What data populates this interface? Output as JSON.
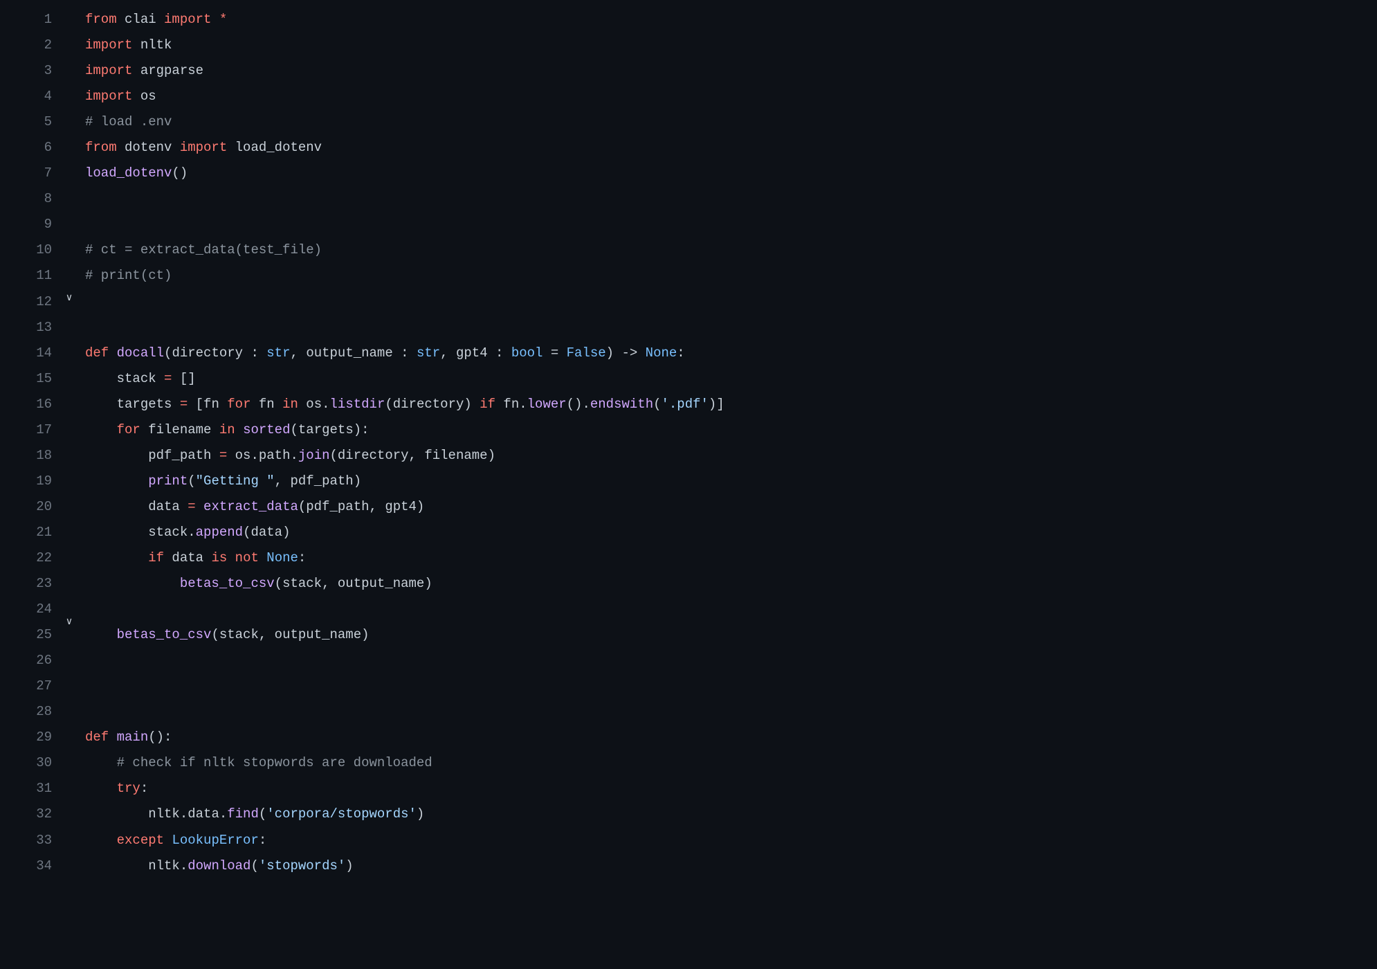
{
  "lines": [
    {
      "n": 1,
      "fold": "",
      "tokens": [
        [
          "kw-import",
          "from"
        ],
        [
          "",
          ""
        ],
        [
          "ident",
          " clai "
        ],
        [
          "kw-import",
          "import"
        ],
        [
          "op",
          " *"
        ]
      ]
    },
    {
      "n": 2,
      "fold": "",
      "tokens": [
        [
          "kw-import",
          "import"
        ],
        [
          "ident",
          " nltk"
        ]
      ]
    },
    {
      "n": 3,
      "fold": "",
      "tokens": [
        [
          "kw-import",
          "import"
        ],
        [
          "ident",
          " argparse"
        ]
      ]
    },
    {
      "n": 4,
      "fold": "",
      "tokens": [
        [
          "kw-import",
          "import"
        ],
        [
          "ident",
          " os"
        ]
      ]
    },
    {
      "n": 5,
      "fold": "",
      "tokens": [
        [
          "comment",
          "# load .env"
        ]
      ]
    },
    {
      "n": 6,
      "fold": "",
      "tokens": [
        [
          "kw-import",
          "from"
        ],
        [
          "ident",
          " dotenv "
        ],
        [
          "kw-import",
          "import"
        ],
        [
          "ident",
          " load_dotenv"
        ]
      ]
    },
    {
      "n": 7,
      "fold": "",
      "tokens": [
        [
          "call",
          "load_dotenv"
        ],
        [
          "punct",
          "()"
        ]
      ]
    },
    {
      "n": 8,
      "fold": "",
      "tokens": [
        [
          "",
          ""
        ]
      ]
    },
    {
      "n": 9,
      "fold": "",
      "tokens": [
        [
          "",
          ""
        ]
      ]
    },
    {
      "n": 10,
      "fold": "",
      "tokens": [
        [
          "comment",
          "# ct = extract_data(test_file)"
        ]
      ]
    },
    {
      "n": 11,
      "fold": "",
      "tokens": [
        [
          "comment",
          "# print(ct)"
        ]
      ]
    },
    {
      "n": 12,
      "fold": "",
      "tokens": [
        [
          "",
          ""
        ]
      ]
    },
    {
      "n": 13,
      "fold": "",
      "tokens": [
        [
          "",
          ""
        ]
      ]
    },
    {
      "n": 14,
      "fold": "v",
      "tokens": [
        [
          "kw-def",
          "def "
        ],
        [
          "fn",
          "docall"
        ],
        [
          "punct",
          "("
        ],
        [
          "param",
          "directory"
        ],
        [
          "punct",
          " : "
        ],
        [
          "builtin-type",
          "str"
        ],
        [
          "punct",
          ", "
        ],
        [
          "param",
          "output_name"
        ],
        [
          "punct",
          " : "
        ],
        [
          "builtin-type",
          "str"
        ],
        [
          "punct",
          ", "
        ],
        [
          "param",
          "gpt4"
        ],
        [
          "punct",
          " : "
        ],
        [
          "builtin-type",
          "bool"
        ],
        [
          "punct",
          " = "
        ],
        [
          "const",
          "False"
        ],
        [
          "punct",
          ") -> "
        ],
        [
          "const",
          "None"
        ],
        [
          "punct",
          ":"
        ]
      ]
    },
    {
      "n": 15,
      "fold": "",
      "tokens": [
        [
          "ident",
          "    stack "
        ],
        [
          "op",
          "="
        ],
        [
          "punct",
          " []"
        ]
      ]
    },
    {
      "n": 16,
      "fold": "",
      "tokens": [
        [
          "ident",
          "    targets "
        ],
        [
          "op",
          "="
        ],
        [
          "punct",
          " ["
        ],
        [
          "ident",
          "fn "
        ],
        [
          "kw-flow",
          "for"
        ],
        [
          "ident",
          " fn "
        ],
        [
          "kw-flow",
          "in"
        ],
        [
          "ident",
          " os"
        ],
        [
          "punct",
          "."
        ],
        [
          "call",
          "listdir"
        ],
        [
          "punct",
          "("
        ],
        [
          "ident",
          "directory"
        ],
        [
          "punct",
          ") "
        ],
        [
          "kw-flow",
          "if"
        ],
        [
          "ident",
          " fn"
        ],
        [
          "punct",
          "."
        ],
        [
          "call",
          "lower"
        ],
        [
          "punct",
          "()."
        ],
        [
          "call",
          "endswith"
        ],
        [
          "punct",
          "("
        ],
        [
          "string",
          "'.pdf'"
        ],
        [
          "punct",
          ")]"
        ]
      ]
    },
    {
      "n": 17,
      "fold": "",
      "tokens": [
        [
          "ident",
          "    "
        ],
        [
          "kw-flow",
          "for"
        ],
        [
          "ident",
          " filename "
        ],
        [
          "kw-flow",
          "in"
        ],
        [
          "ident",
          " "
        ],
        [
          "call",
          "sorted"
        ],
        [
          "punct",
          "("
        ],
        [
          "ident",
          "targets"
        ],
        [
          "punct",
          "):"
        ]
      ]
    },
    {
      "n": 18,
      "fold": "",
      "tokens": [
        [
          "ident",
          "        pdf_path "
        ],
        [
          "op",
          "="
        ],
        [
          "ident",
          " os"
        ],
        [
          "punct",
          "."
        ],
        [
          "ident",
          "path"
        ],
        [
          "punct",
          "."
        ],
        [
          "call",
          "join"
        ],
        [
          "punct",
          "("
        ],
        [
          "ident",
          "directory"
        ],
        [
          "punct",
          ", "
        ],
        [
          "ident",
          "filename"
        ],
        [
          "punct",
          ")"
        ]
      ]
    },
    {
      "n": 19,
      "fold": "",
      "tokens": [
        [
          "ident",
          "        "
        ],
        [
          "call",
          "print"
        ],
        [
          "punct",
          "("
        ],
        [
          "string",
          "\"Getting \""
        ],
        [
          "punct",
          ", "
        ],
        [
          "ident",
          "pdf_path"
        ],
        [
          "punct",
          ")"
        ]
      ]
    },
    {
      "n": 20,
      "fold": "",
      "tokens": [
        [
          "ident",
          "        data "
        ],
        [
          "op",
          "="
        ],
        [
          "ident",
          " "
        ],
        [
          "call",
          "extract_data"
        ],
        [
          "punct",
          "("
        ],
        [
          "ident",
          "pdf_path"
        ],
        [
          "punct",
          ", "
        ],
        [
          "ident",
          "gpt4"
        ],
        [
          "punct",
          ")"
        ]
      ]
    },
    {
      "n": 21,
      "fold": "",
      "tokens": [
        [
          "ident",
          "        stack"
        ],
        [
          "punct",
          "."
        ],
        [
          "call",
          "append"
        ],
        [
          "punct",
          "("
        ],
        [
          "ident",
          "data"
        ],
        [
          "punct",
          ")"
        ]
      ]
    },
    {
      "n": 22,
      "fold": "",
      "tokens": [
        [
          "ident",
          "        "
        ],
        [
          "kw-flow",
          "if"
        ],
        [
          "ident",
          " data "
        ],
        [
          "kw-flow",
          "is"
        ],
        [
          "ident",
          " "
        ],
        [
          "kw-flow",
          "not"
        ],
        [
          "ident",
          " "
        ],
        [
          "const",
          "None"
        ],
        [
          "punct",
          ":"
        ]
      ]
    },
    {
      "n": 23,
      "fold": "",
      "tokens": [
        [
          "ident",
          "            "
        ],
        [
          "call",
          "betas_to_csv"
        ],
        [
          "punct",
          "("
        ],
        [
          "ident",
          "stack"
        ],
        [
          "punct",
          ", "
        ],
        [
          "ident",
          "output_name"
        ],
        [
          "punct",
          ")"
        ]
      ]
    },
    {
      "n": 24,
      "fold": "",
      "tokens": [
        [
          "",
          ""
        ]
      ]
    },
    {
      "n": 25,
      "fold": "",
      "tokens": [
        [
          "ident",
          "    "
        ],
        [
          "call",
          "betas_to_csv"
        ],
        [
          "punct",
          "("
        ],
        [
          "ident",
          "stack"
        ],
        [
          "punct",
          ", "
        ],
        [
          "ident",
          "output_name"
        ],
        [
          "punct",
          ")"
        ]
      ]
    },
    {
      "n": 26,
      "fold": "",
      "tokens": [
        [
          "",
          ""
        ]
      ]
    },
    {
      "n": 27,
      "fold": "",
      "tokens": [
        [
          "",
          ""
        ]
      ]
    },
    {
      "n": 28,
      "fold": "",
      "tokens": [
        [
          "",
          ""
        ]
      ]
    },
    {
      "n": 29,
      "fold": "v",
      "tokens": [
        [
          "kw-def",
          "def "
        ],
        [
          "fn",
          "main"
        ],
        [
          "punct",
          "():"
        ]
      ]
    },
    {
      "n": 30,
      "fold": "",
      "tokens": [
        [
          "ident",
          "    "
        ],
        [
          "comment",
          "# check if nltk stopwords are downloaded"
        ]
      ]
    },
    {
      "n": 31,
      "fold": "",
      "tokens": [
        [
          "ident",
          "    "
        ],
        [
          "kw-flow",
          "try"
        ],
        [
          "punct",
          ":"
        ]
      ]
    },
    {
      "n": 32,
      "fold": "",
      "tokens": [
        [
          "ident",
          "        nltk"
        ],
        [
          "punct",
          "."
        ],
        [
          "ident",
          "data"
        ],
        [
          "punct",
          "."
        ],
        [
          "call",
          "find"
        ],
        [
          "punct",
          "("
        ],
        [
          "string",
          "'corpora/stopwords'"
        ],
        [
          "punct",
          ")"
        ]
      ]
    },
    {
      "n": 33,
      "fold": "",
      "tokens": [
        [
          "ident",
          "    "
        ],
        [
          "kw-flow",
          "except"
        ],
        [
          "ident",
          " "
        ],
        [
          "builtin-type",
          "LookupError"
        ],
        [
          "punct",
          ":"
        ]
      ]
    },
    {
      "n": 34,
      "fold": "",
      "tokens": [
        [
          "ident",
          "        nltk"
        ],
        [
          "punct",
          "."
        ],
        [
          "call",
          "download"
        ],
        [
          "punct",
          "("
        ],
        [
          "string",
          "'stopwords'"
        ],
        [
          "punct",
          ")"
        ]
      ]
    }
  ]
}
